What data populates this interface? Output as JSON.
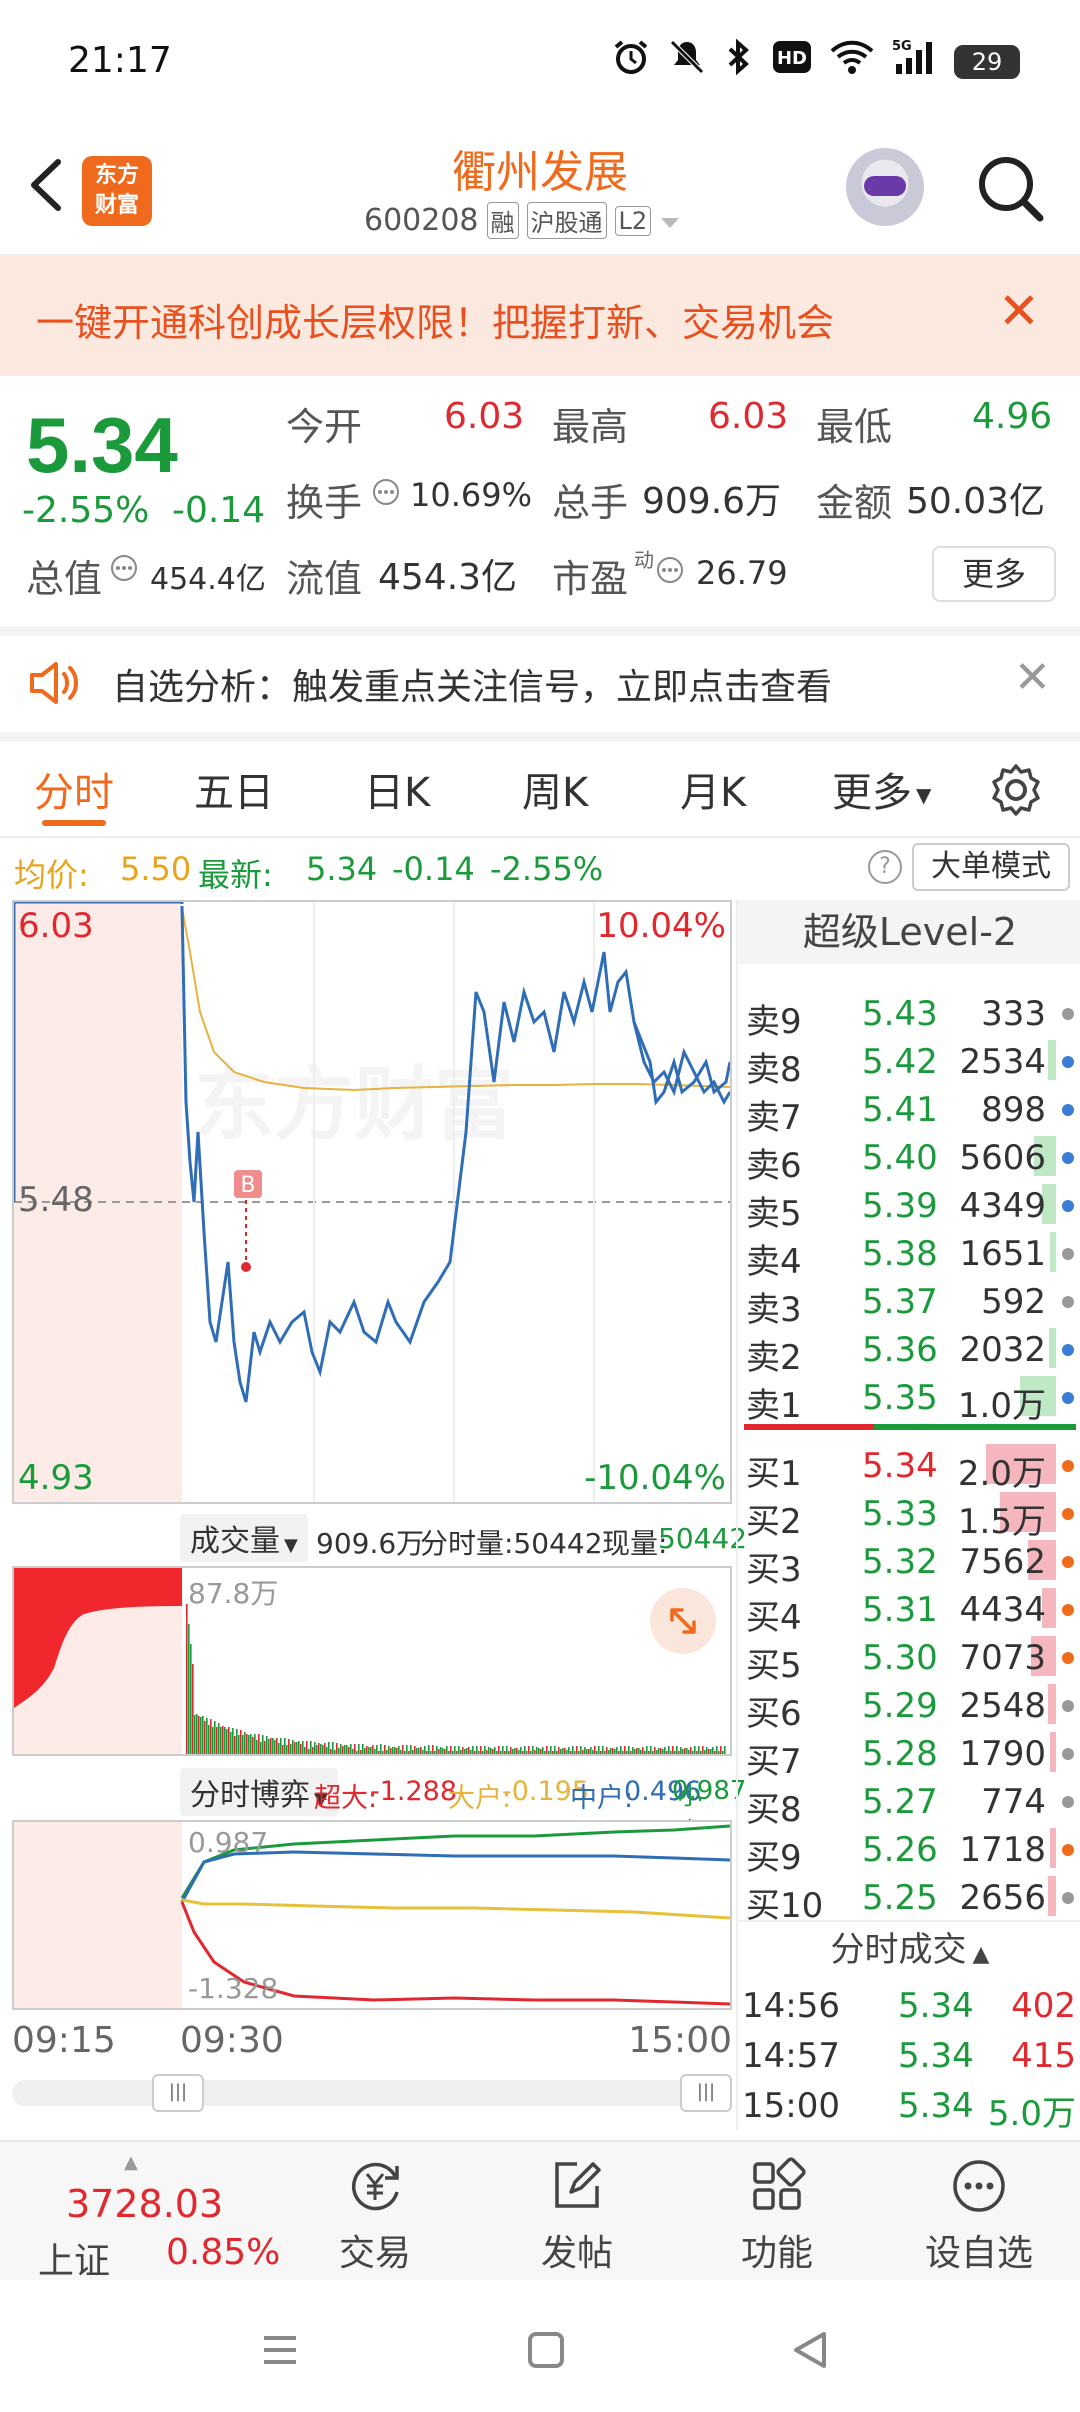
{
  "status_bar": {
    "time": "21:17",
    "signal": "5G",
    "battery": "29"
  },
  "header": {
    "logo_line1": "东方",
    "logo_line2": "财富",
    "stock_name": "衢州发展",
    "stock_code": "600208",
    "tags": [
      "融",
      "沪股通",
      "L2"
    ]
  },
  "promo": {
    "text": "一键开通科创成长层权限！把握打新、交易机会"
  },
  "quote": {
    "price": "5.34",
    "change_pct": "-2.55%",
    "change_val": "-0.14",
    "open_label": "今开",
    "open": "6.03",
    "high_label": "最高",
    "high": "6.03",
    "low_label": "最低",
    "low": "4.96",
    "turnover_label": "换手",
    "turnover": "10.69%",
    "volume_label": "总手",
    "volume": "909.6万",
    "amount_label": "金额",
    "amount": "50.03亿",
    "mktcap_label": "总值",
    "mktcap": "454.4亿",
    "float_label": "流值",
    "float": "454.3亿",
    "pe_label": "市盈",
    "pe_sup": "动",
    "pe": "26.79",
    "more": "更多"
  },
  "analysis": {
    "text": "自选分析：触发重点关注信号，立即点击查看"
  },
  "tabs": [
    "分时",
    "五日",
    "日K",
    "周K",
    "月K",
    "更多"
  ],
  "info_row": {
    "avg_label": "均价:",
    "avg": "5.50",
    "last_label": "最新:",
    "last": "5.34",
    "chg": "-0.14",
    "pct": "-2.55%",
    "big_mode": "大单模式"
  },
  "price_chart": {
    "top_price": "6.03",
    "top_pct": "10.04%",
    "mid_price": "5.48",
    "bottom_price": "4.93",
    "bottom_pct": "-10.04%",
    "watermark": "东方财富",
    "marker": "B"
  },
  "volume_header": {
    "select": "成交量",
    "total": "909.6万",
    "tick_label": "分时量:50442",
    "cur_label": "现量:",
    "cur": "50442",
    "max": "87.8万"
  },
  "flow_header": {
    "select": "分时博弈",
    "super_label": "超大:",
    "super": "-1.288",
    "large_label": "大户:",
    "large": "-0.195",
    "mid_label": "中户:",
    "mid": "0.496",
    "small_label": "小户:",
    "small": "0.987"
  },
  "flow_chart": {
    "top": "0.987",
    "bottom": "-1.328"
  },
  "time_axis": [
    "09:15",
    "09:30",
    "15:00"
  ],
  "level2": {
    "title": "超级Level-2",
    "asks": [
      {
        "label": "卖9",
        "price": "5.43",
        "vol": "333",
        "fill": 0,
        "dot": "#999"
      },
      {
        "label": "卖8",
        "price": "5.42",
        "vol": "2534",
        "fill": 0.06,
        "dot": "#3a7bd5"
      },
      {
        "label": "卖7",
        "price": "5.41",
        "vol": "898",
        "fill": 0,
        "dot": "#3a7bd5"
      },
      {
        "label": "卖6",
        "price": "5.40",
        "vol": "5606",
        "fill": 0.16,
        "dot": "#3a7bd5"
      },
      {
        "label": "卖5",
        "price": "5.39",
        "vol": "4349",
        "fill": 0.1,
        "dot": "#3a7bd5"
      },
      {
        "label": "卖4",
        "price": "5.38",
        "vol": "1651",
        "fill": 0.04,
        "dot": "#999"
      },
      {
        "label": "卖3",
        "price": "5.37",
        "vol": "592",
        "fill": 0,
        "dot": "#999"
      },
      {
        "label": "卖2",
        "price": "5.36",
        "vol": "2032",
        "fill": 0.05,
        "dot": "#3a7bd5"
      },
      {
        "label": "卖1",
        "price": "5.35",
        "vol": "1.0万",
        "fill": 0.26,
        "dot": "#3a7bd5"
      }
    ],
    "bids": [
      {
        "label": "买1",
        "price": "5.34",
        "vol": "2.0万",
        "fill": 0.5,
        "dot": "#ef6a1c"
      },
      {
        "label": "买2",
        "price": "5.33",
        "vol": "1.5万",
        "fill": 0.4,
        "dot": "#ef6a1c"
      },
      {
        "label": "买3",
        "price": "5.32",
        "vol": "7562",
        "fill": 0.2,
        "dot": "#ef6a1c"
      },
      {
        "label": "买4",
        "price": "5.31",
        "vol": "4434",
        "fill": 0.1,
        "dot": "#ef6a1c"
      },
      {
        "label": "买5",
        "price": "5.30",
        "vol": "7073",
        "fill": 0.18,
        "dot": "#ef6a1c"
      },
      {
        "label": "买6",
        "price": "5.29",
        "vol": "2548",
        "fill": 0.06,
        "dot": "#999"
      },
      {
        "label": "买7",
        "price": "5.28",
        "vol": "1790",
        "fill": 0.04,
        "dot": "#999"
      },
      {
        "label": "买8",
        "price": "5.27",
        "vol": "774",
        "fill": 0,
        "dot": "#999"
      },
      {
        "label": "买9",
        "price": "5.26",
        "vol": "1718",
        "fill": 0.04,
        "dot": "#ef6a1c"
      },
      {
        "label": "买10",
        "price": "5.25",
        "vol": "2656",
        "fill": 0.06,
        "dot": "#999"
      }
    ],
    "trades_title": "分时成交",
    "trades": [
      {
        "time": "14:56",
        "price": "5.34",
        "vol": "402"
      },
      {
        "time": "14:57",
        "price": "5.34",
        "vol": "415"
      },
      {
        "time": "15:00",
        "price": "5.34",
        "vol": "5.0万"
      }
    ]
  },
  "bottom_nav": {
    "index_val": "3728.03",
    "index_name": "上证",
    "index_chg": "0.85%",
    "items": [
      "交易",
      "发帖",
      "功能",
      "设自选"
    ]
  }
}
